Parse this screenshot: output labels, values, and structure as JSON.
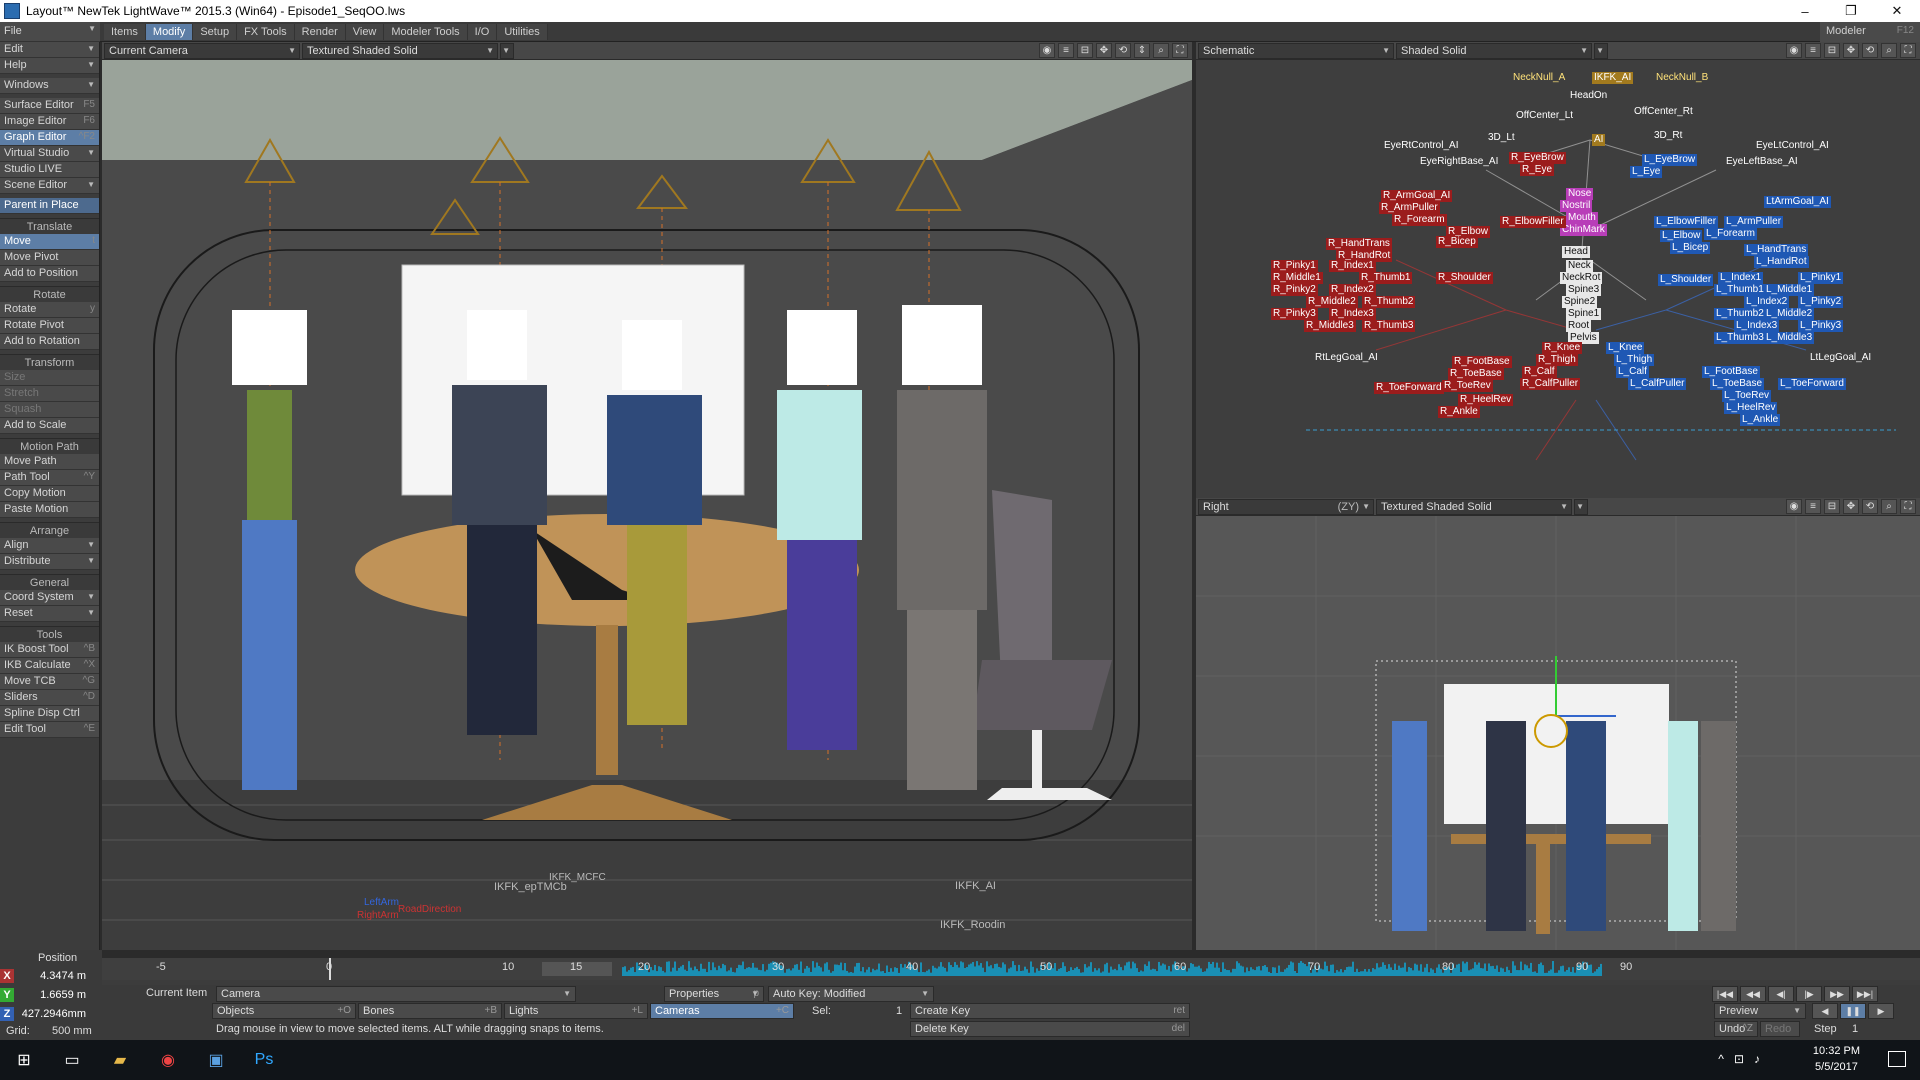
{
  "window": {
    "title": "Layout™ NewTek LightWave™ 2015.3 (Win64) - Episode1_SeqOO.lws",
    "min": "–",
    "max": "❐",
    "close": "✕"
  },
  "menubar": {
    "file": "File",
    "tabs": [
      "Items",
      "Modify",
      "Setup",
      "FX Tools",
      "Render",
      "View",
      "Modeler Tools",
      "I/O",
      "Utilities"
    ],
    "active_tab": "Modify",
    "modeler": "Modeler",
    "modeler_shortcut": "F12"
  },
  "lefttools": {
    "top": [
      {
        "label": "Edit",
        "dd": true
      },
      {
        "label": "Help",
        "dd": true
      }
    ],
    "windows": {
      "label": "Windows",
      "dd": true
    },
    "editors": [
      {
        "label": "Surface Editor",
        "sc": "F5"
      },
      {
        "label": "Image Editor",
        "sc": "F6"
      },
      {
        "label": "Graph Editor",
        "sc": "^F2",
        "hl": true
      },
      {
        "label": "Virtual Studio",
        "dd": true
      },
      {
        "label": "Studio LIVE"
      },
      {
        "label": "Scene Editor",
        "dd": true
      }
    ],
    "parent_in_place": "Parent in Place",
    "sections": [
      {
        "head": "Translate",
        "items": [
          {
            "label": "Move",
            "sc": "t",
            "hl": true
          },
          {
            "label": "Move Pivot"
          },
          {
            "label": "Add to Position"
          }
        ]
      },
      {
        "head": "Rotate",
        "items": [
          {
            "label": "Rotate",
            "sc": "y"
          },
          {
            "label": "Rotate Pivot"
          },
          {
            "label": "Add to Rotation"
          }
        ]
      },
      {
        "head": "Transform",
        "items": [
          {
            "label": "Size",
            "dim": true
          },
          {
            "label": "Stretch",
            "dim": true
          },
          {
            "label": "Squash",
            "dim": true
          },
          {
            "label": "Add to Scale"
          }
        ]
      },
      {
        "head": "Motion Path",
        "items": [
          {
            "label": "Move Path"
          },
          {
            "label": "Path Tool",
            "sc": "^Y"
          },
          {
            "label": "Copy Motion"
          },
          {
            "label": "Paste Motion"
          }
        ]
      },
      {
        "head": "Arrange",
        "items": [
          {
            "label": "Align",
            "dd": true
          },
          {
            "label": "Distribute",
            "dd": true
          }
        ]
      },
      {
        "head": "General",
        "items": [
          {
            "label": "Coord System",
            "dd": true
          },
          {
            "label": "Reset",
            "dd": true
          }
        ]
      },
      {
        "head": "Tools",
        "items": [
          {
            "label": "IK Boost Tool",
            "sc": "^B"
          },
          {
            "label": "IKB Calculate",
            "sc": "^X"
          },
          {
            "label": "Move TCB",
            "sc": "^G"
          },
          {
            "label": "Sliders",
            "sc": "^D"
          },
          {
            "label": "Spline Disp Ctrl"
          },
          {
            "label": "Edit Tool",
            "sc": "^E"
          }
        ]
      }
    ]
  },
  "viewports": {
    "camera": {
      "view": "Current Camera",
      "shading": "Textured Shaded Solid",
      "labels": [
        "IKFK_epTMCb",
        "IKFK_AI",
        "IKFK_Roodin",
        "IKFK_MCFC",
        "LeftArm",
        "RightArm",
        "RoadDirection"
      ]
    },
    "schematic": {
      "view": "Schematic",
      "shading": "Shaded Solid"
    },
    "right": {
      "view": "Right",
      "axes": "(ZY)",
      "shading": "Textured Shaded Solid"
    }
  },
  "schematic_nodes": {
    "white_text": [
      "NeckNull_A",
      "NeckNull_B",
      "HeadOn",
      "OffCenter_Lt",
      "OffCenter_Rt",
      "EyeRtControl_AI",
      "EyeRightBase_AI",
      "EyeLtControl_AI",
      "EyeLeftBase_AI",
      "RtLegGoal_AI",
      "LtLegGoal_AI",
      "3D_Lt",
      "3D_Rt"
    ],
    "gold": [
      "IKFK_AI",
      "AI"
    ],
    "pink": [
      "Nose",
      "Nostril",
      "Mouth",
      "ChinMark"
    ],
    "spine": [
      "Head",
      "Neck",
      "NeckRot",
      "Spine3",
      "Spine2",
      "Spine1",
      "Root",
      "Pelvis"
    ],
    "red": [
      "R_ArmGoal_AI",
      "R_ArmPuller",
      "R_Forearm",
      "R_EyeBrow",
      "R_Eye",
      "R_ElbowFiller",
      "R_Elbow",
      "R_Bicep",
      "R_HandTrans",
      "R_HandRot",
      "R_Pinky1",
      "R_Index1",
      "R_Middle1",
      "R_Thumb1",
      "R_Pinky2",
      "R_Index2",
      "R_Middle2",
      "R_Thumb2",
      "R_Pinky3",
      "R_Index3",
      "R_Middle3",
      "R_Thumb3",
      "R_Shoulder",
      "R_Knee",
      "R_Thigh",
      "R_FootBase",
      "R_ToeBase",
      "R_Calf",
      "R_ToeRev",
      "R_CalfPuller",
      "R_ToeForward",
      "R_HeelRev",
      "R_Ankle"
    ],
    "blue": [
      "L_EyeBrow",
      "L_Eye",
      "LtArmGoal_AI",
      "L_ElbowFiller",
      "L_ArmPuller",
      "L_Forearm",
      "L_Elbow",
      "L_Bicep",
      "L_HandTrans",
      "L_HandRot",
      "L_Index1",
      "L_Pinky1",
      "L_Thumb1",
      "L_Middle1",
      "L_Index2",
      "L_Pinky2",
      "L_Thumb2",
      "L_Middle2",
      "L_Index3",
      "L_Pinky3",
      "L_Thumb3",
      "L_Middle3",
      "L_Shoulder",
      "L_Knee",
      "L_Thigh",
      "L_Calf",
      "L_CalfPuller",
      "L_FootBase",
      "L_ToeBase",
      "L_ToeForward",
      "L_ToeRev",
      "L_HeelRev",
      "L_Ankle"
    ]
  },
  "position": {
    "title": "Position",
    "x": "4.3474 m",
    "y": "1.6659 m",
    "z": "427.2946mm",
    "grid_label": "Grid:",
    "grid_value": "500 mm"
  },
  "timeline": {
    "ticks": [
      "-5",
      "0",
      "10",
      "15",
      "20",
      "30",
      "40",
      "50",
      "60",
      "70",
      "80",
      "90",
      "90"
    ],
    "current_frame": "15"
  },
  "bottom": {
    "current_item_label": "Current Item",
    "current_item": "Camera",
    "properties": "Properties",
    "properties_sc": "p",
    "auto_key": "Auto Key: Modified",
    "objects": "Objects",
    "objects_sc": "+O",
    "bones": "Bones",
    "bones_sc": "+B",
    "lights": "Lights",
    "lights_sc": "+L",
    "cameras": "Cameras",
    "cameras_sc": "+C",
    "sel_label": "Sel:",
    "sel_value": "1",
    "create_key": "Create Key",
    "create_key_sc": "ret",
    "delete_key": "Delete Key",
    "delete_key_sc": "del",
    "preview": "Preview",
    "undo": "Undo",
    "undo_sc": "^Z",
    "redo": "Redo",
    "step_label": "Step",
    "step_value": "1",
    "status": "Drag mouse in view to move selected items. ALT while dragging snaps to items."
  },
  "taskbar": {
    "time": "10:32 PM",
    "date": "5/5/2017"
  },
  "colors": {
    "accent": "#5d7ea6",
    "node_red": "#9b1c1c",
    "node_blue": "#1f58b4",
    "audio": "#1a8fb4"
  }
}
